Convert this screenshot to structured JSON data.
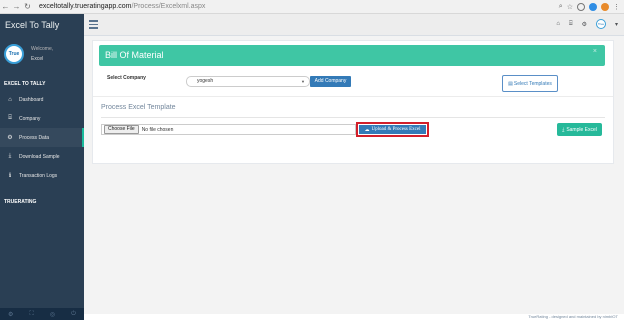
{
  "browser": {
    "url_domain": "exceltotally.trueratingapp.com",
    "url_path": "/Process/Excelxml.aspx",
    "back_icon": "arrow-left-icon",
    "forward_icon": "arrow-right-icon",
    "reload_icon": "reload-icon"
  },
  "sidebar": {
    "brand": "Excel To Tally",
    "welcome": "Welcome,",
    "username": "Excel",
    "avatar_text": "True",
    "section_title": "EXCEL TO TALLY",
    "items": [
      {
        "label": "Dashboard",
        "icon": "home-icon"
      },
      {
        "label": "Company",
        "icon": "bank-icon"
      },
      {
        "label": "Process Data",
        "icon": "cogs-icon"
      },
      {
        "label": "Download Sample",
        "icon": "download-icon"
      },
      {
        "label": "Transaction Logs",
        "icon": "info-icon"
      }
    ],
    "section_title_2": "TRUERATING",
    "footer_icons": [
      "settings-icon",
      "fullscreen-icon",
      "eye-slash-icon",
      "power-icon"
    ]
  },
  "topnav": {
    "icons": [
      "home-icon",
      "bank-icon",
      "cogs-icon"
    ],
    "avatar_text": "True"
  },
  "panel": {
    "header_title": "Bill Of Material",
    "select_company_label": "Select Company",
    "select_company_value": "yogesh",
    "add_company_label": "Add Company",
    "select_templates_label": "Select Templates",
    "process_title": "Process Excel Template",
    "choose_file_label": "Choose File",
    "no_file_text": "No file chosen",
    "upload_label": "Upload & Process Excel",
    "sample_label": "Sample Excel"
  },
  "footer": {
    "text": "TrueRating - designed and maintained by nimbIOT"
  },
  "colors": {
    "sidebar": "#2a3f54",
    "header": "#3fc6a4",
    "primary": "#337ab7",
    "success": "#26b99a",
    "highlight": "#d21f2a"
  }
}
